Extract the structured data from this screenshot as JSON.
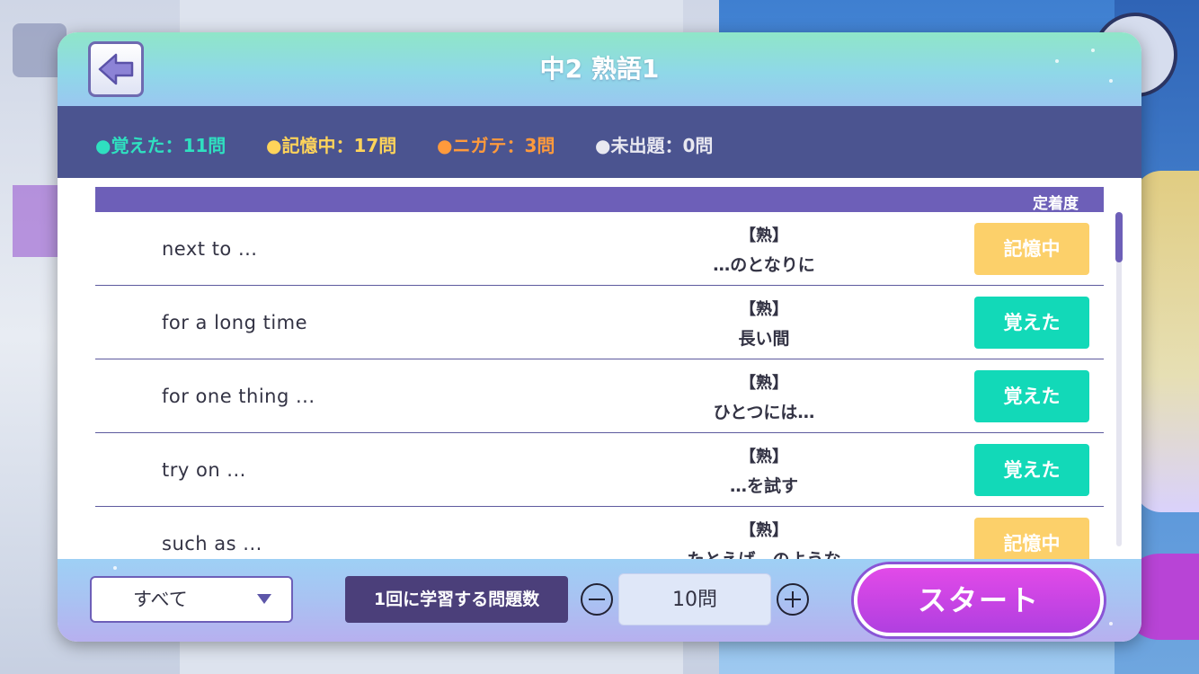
{
  "modal": {
    "title": "中2 熟語1",
    "back_icon": "back-arrow-icon"
  },
  "stats": [
    {
      "label": "●覚えた：11問",
      "color": "#2fe0c0"
    },
    {
      "label": "●記憶中：17問",
      "color": "#ffd45a"
    },
    {
      "label": "●ニガテ：3問",
      "color": "#ff9a3c"
    },
    {
      "label": "●未出題：0問",
      "color": "#e8e8f0"
    }
  ],
  "list": {
    "header_label": "定着度",
    "rows": [
      {
        "english": "next to ...",
        "tag": "【熟】",
        "japanese": "…のとなりに",
        "status": "記憶中",
        "status_color": "#fcd06a"
      },
      {
        "english": "for a long time",
        "tag": "【熟】",
        "japanese": "長い間",
        "status": "覚えた",
        "status_color": "#12d9b8"
      },
      {
        "english": "for one thing ...",
        "tag": "【熟】",
        "japanese": "ひとつには…",
        "status": "覚えた",
        "status_color": "#12d9b8"
      },
      {
        "english": "try on ...",
        "tag": "【熟】",
        "japanese": "…を試す",
        "status": "覚えた",
        "status_color": "#12d9b8"
      },
      {
        "english": "such as ...",
        "tag": "【熟】",
        "japanese": "たとえば…のような",
        "status": "記憶中",
        "status_color": "#fcd06a"
      }
    ]
  },
  "footer": {
    "filter_value": "すべて",
    "count_label": "1回に学習する問題数",
    "count_value": "10問",
    "start_label": "スタート"
  }
}
